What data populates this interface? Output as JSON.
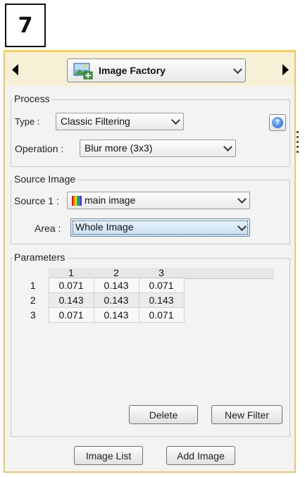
{
  "step_number": "7",
  "factory": {
    "label": "Image Factory",
    "icon": "image-factory-icon"
  },
  "process": {
    "legend": "Process",
    "type_label": "Type :",
    "type_value": "Classic Filtering",
    "operation_label": "Operation :",
    "operation_value": "Blur more (3x3)"
  },
  "source": {
    "legend": "Source Image",
    "source_label": "Source 1 :",
    "source_value": "main image",
    "area_label": "Area :",
    "area_value": "Whole Image"
  },
  "parameters": {
    "legend": "Parameters",
    "columns": [
      "1",
      "2",
      "3"
    ],
    "rows": [
      {
        "label": "1",
        "cells": [
          "0.071",
          "0.143",
          "0.071"
        ]
      },
      {
        "label": "2",
        "cells": [
          "0.143",
          "0.143",
          "0.143"
        ]
      },
      {
        "label": "3",
        "cells": [
          "0.071",
          "0.143",
          "0.071"
        ]
      }
    ],
    "delete_label": "Delete",
    "new_filter_label": "New Filter"
  },
  "footer": {
    "image_list_label": "Image List",
    "add_image_label": "Add Image"
  },
  "colors": {
    "panel_border": "#e8c96a",
    "topbar_bg": "#f6f1d6",
    "focus_bg": "#c9dff2"
  }
}
